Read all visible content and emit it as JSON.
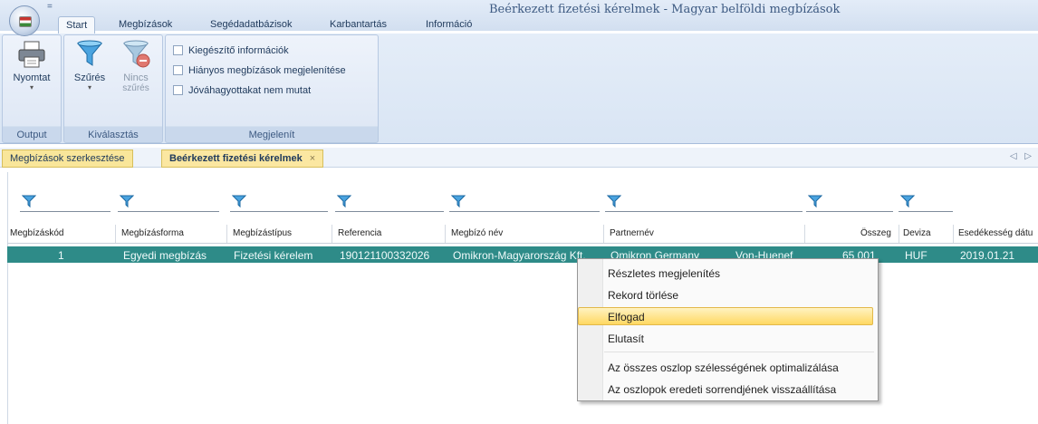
{
  "window": {
    "title": "Beérkezett fizetési kérelmek - Magyar belföldi megbízások",
    "qat_label": "="
  },
  "ribbon": {
    "tabs": [
      "Start",
      "Megbízások",
      "Segédadatbázisok",
      "Karbantartás",
      "Információ"
    ],
    "active_tab": "Start",
    "groups": {
      "output": {
        "label": "Output",
        "print_label": "Nyomtat"
      },
      "selection": {
        "label": "Kiválasztás",
        "filter_label": "Szűrés",
        "no_filter_label_1": "Nincs",
        "no_filter_label_2": "szűrés"
      },
      "display": {
        "label": "Megjelenít",
        "options": [
          "Kiegészítő információk",
          "Hiányos megbízások megjelenítése",
          "Jóváhagyottakat nem mutat"
        ]
      }
    }
  },
  "doc_tabs": {
    "inactive": "Megbízások szerkesztése",
    "active": "Beérkezett fizetési kérelmek",
    "close": "×",
    "arrows": "◁ ▷"
  },
  "grid": {
    "columns": [
      "Megbízáskód",
      "Megbízásforma",
      "Megbízástípus",
      "Referencia",
      "Megbízó név",
      "Partnernév",
      "Összeg",
      "Deviza",
      "Esedékesség dátu"
    ],
    "rows": [
      {
        "code": "1",
        "form": "Egyedi megbízás",
        "type": "Fizetési kérelem",
        "reference": "190121100332026",
        "principal": "Omikron-Magyarország Kft.",
        "partner": "Omikron Germany",
        "partner_extra": "Von-Huenef",
        "amount": "65 001",
        "currency": "HUF",
        "due_date": "2019.01.21"
      }
    ]
  },
  "context_menu": {
    "items": [
      "Részletes megjelenítés",
      "Rekord törlése",
      "Elfogad",
      "Elutasít",
      "Az összes oszlop szélességének optimalizálása",
      "Az oszlopok eredeti sorrendjének visszaállítása"
    ],
    "highlighted": "Elfogad"
  },
  "colors": {
    "selected_row": "#2e8b88",
    "menu_highlight": "#ffd862",
    "doc_tab": "#fbe7a1"
  }
}
